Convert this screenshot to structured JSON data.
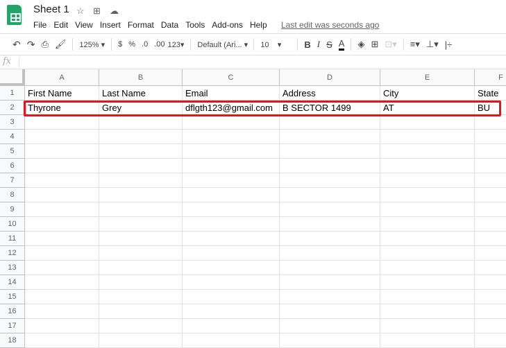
{
  "app": {
    "title": "Sheet 1",
    "last_edit": "Last edit was seconds ago"
  },
  "menu": [
    "File",
    "Edit",
    "View",
    "Insert",
    "Format",
    "Data",
    "Tools",
    "Add-ons",
    "Help"
  ],
  "toolbar": {
    "zoom": "125%",
    "currency": "$",
    "percent": "%",
    "dec_decrease": ".0",
    "dec_increase": ".00",
    "number_format": "123",
    "font": "Default (Ari...",
    "font_size": "10",
    "bold": "B",
    "italic": "I",
    "strike": "S",
    "text_color": "A",
    "text_color_value": "#000000"
  },
  "formula_bar": {
    "fx": "fx",
    "value": ""
  },
  "columns": [
    "A",
    "B",
    "C",
    "D",
    "E",
    "F"
  ],
  "rows": [
    "1",
    "2",
    "3",
    "4",
    "5",
    "6",
    "7",
    "8",
    "9",
    "10",
    "11",
    "12",
    "13",
    "14",
    "15",
    "16",
    "17",
    "18"
  ],
  "cells": [
    [
      "First Name",
      "Last Name",
      "Email",
      "Address",
      "City",
      "State"
    ],
    [
      "Thyrone",
      "Grey",
      "dflgth123@gmail.com",
      "B SECTOR 1499",
      "AT",
      "BU"
    ]
  ],
  "highlight_color": "#e8121b"
}
